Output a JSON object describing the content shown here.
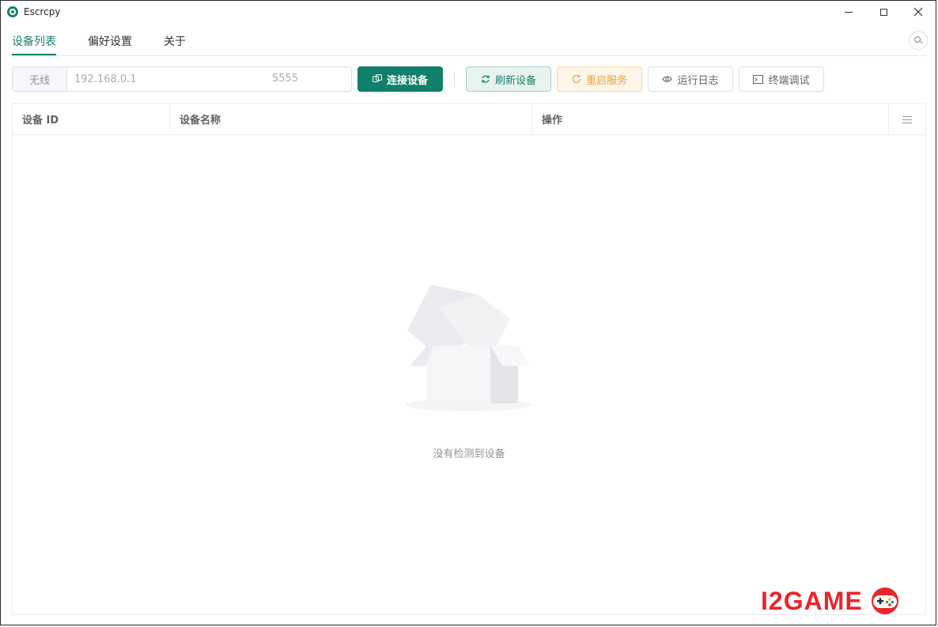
{
  "window": {
    "title": "Escrcpy"
  },
  "tabs": [
    {
      "label": "设备列表",
      "active": true
    },
    {
      "label": "偏好设置",
      "active": false
    },
    {
      "label": "关于",
      "active": false
    }
  ],
  "toolbar": {
    "mode_label": "无线",
    "address_placeholder": "192.168.0.1",
    "port_placeholder": "5555",
    "connect_label": "连接设备",
    "refresh_label": "刷新设备",
    "restart_label": "重启服务",
    "logs_label": "运行日志",
    "terminal_label": "终端调试"
  },
  "table": {
    "columns": [
      "设备 ID",
      "设备名称",
      "操作"
    ]
  },
  "empty_state": {
    "message": "没有检测到设备"
  },
  "watermark": {
    "text": "I2GAME"
  },
  "colors": {
    "accent": "#11806b",
    "warning": "#e6a23c",
    "watermark": "#e8262b"
  }
}
